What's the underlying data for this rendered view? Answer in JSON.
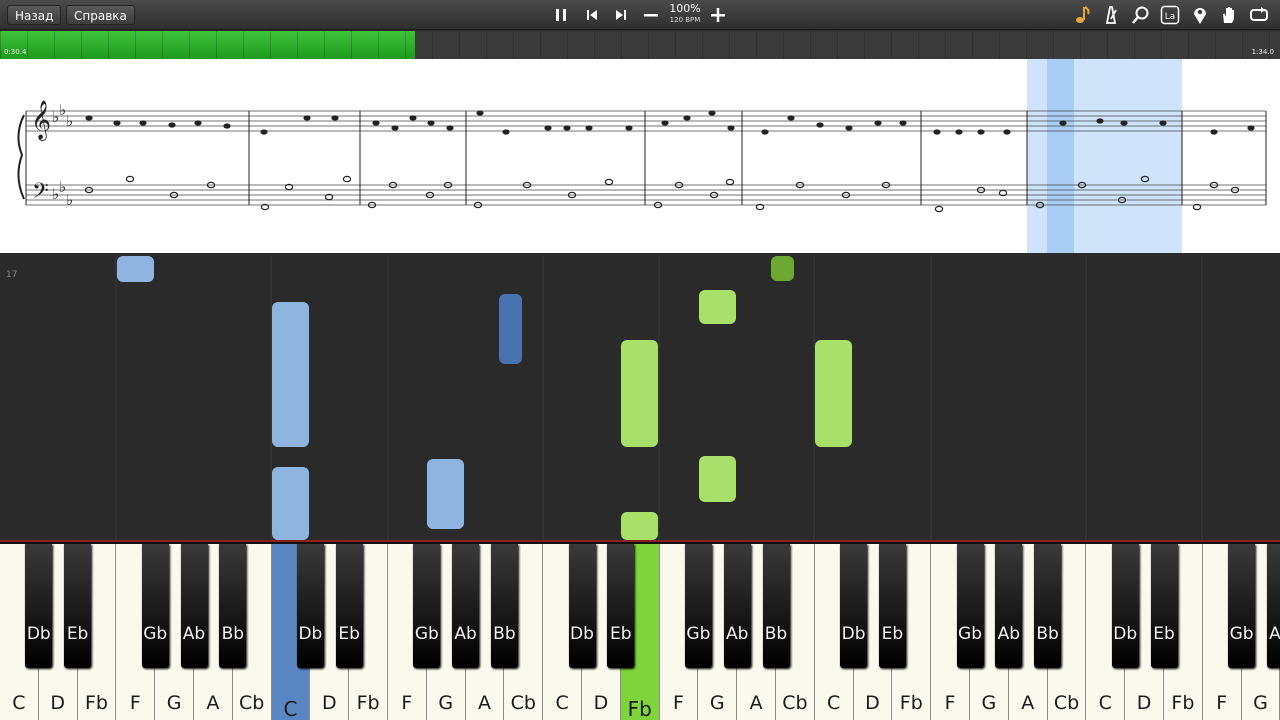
{
  "toolbar": {
    "back_label": "Назад",
    "help_label": "Справка",
    "zoom_percent": "100%",
    "tempo": "120 BPM"
  },
  "icons": [
    "pause-icon",
    "skip-back-icon",
    "skip-forward-icon",
    "minus-icon",
    "plus-icon",
    "note-icon",
    "metronome-icon",
    "magnifier-icon",
    "label-icon",
    "pin-icon",
    "hand-icon",
    "loop-icon"
  ],
  "label_icon_text": "La",
  "progress": {
    "elapsed": "0:30.4",
    "total": "1:34.0",
    "fraction": 0.324
  },
  "roll": {
    "measure_number": "17"
  },
  "colors": {
    "left_hand": "#8fb4e0",
    "left_hand_dark": "#4a72b0",
    "right_hand": "#a8e06a",
    "right_hand_dark": "#6da832",
    "progress": "#2eb02b",
    "selection": "#cfe3fb"
  },
  "keyboard": {
    "white_keys": [
      "C",
      "D",
      "Fb",
      "F",
      "G",
      "A",
      "Cb",
      "C",
      "D",
      "Fb",
      "F",
      "G",
      "A",
      "Cb",
      "C",
      "D",
      "Fb",
      "F",
      "G",
      "A",
      "Cb",
      "C",
      "D",
      "Fb",
      "F",
      "G",
      "A",
      "Cb",
      "C",
      "D",
      "Fb",
      "F",
      "G"
    ],
    "black_keys": [
      "Db",
      "Eb",
      "Gb",
      "Ab",
      "Bb",
      "Db",
      "Eb",
      "Gb",
      "Ab",
      "Bb",
      "Db",
      "Eb",
      "Gb",
      "Ab",
      "Bb",
      "Db",
      "Eb",
      "Gb",
      "Ab",
      "Bb",
      "Db",
      "Eb",
      "Gb",
      "Ab",
      "Bb",
      "Db",
      "Eb",
      "Gb",
      "A"
    ],
    "pressed": [
      {
        "index": 7,
        "hand": "left"
      },
      {
        "index": 16,
        "hand": "right"
      }
    ]
  }
}
